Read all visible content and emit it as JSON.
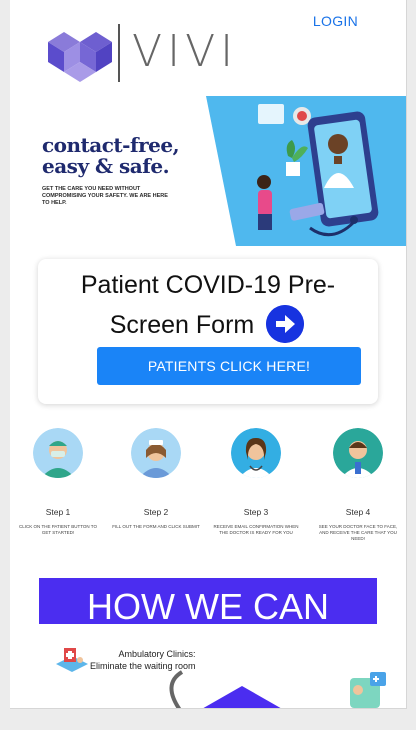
{
  "header": {
    "brand": "VIVI",
    "login_label": "LOGIN"
  },
  "hero": {
    "title_line1": "contact-free,",
    "title_line2": "easy & safe.",
    "subtitle": "GET THE CARE YOU NEED WITHOUT COMPROMISING YOUR SAFETY. WE ARE HERE TO HELP."
  },
  "form_card": {
    "title_line1": "Patient COVID-19 Pre-",
    "title_line2": "Screen Form",
    "button_label": "PATIENTS CLICK HERE!"
  },
  "steps": [
    {
      "label": "Step 1",
      "description": "CLICK ON THE PATIENT BUTTON TO GET STARTED!"
    },
    {
      "label": "Step 2",
      "description": "FILL OUT THE FORM AND CLICK SUBMIT"
    },
    {
      "label": "Step 3",
      "description": "RECEIVE EMAIL CONFIRMATION WHEN THE DOCTOR IS READY FOR YOU"
    },
    {
      "label": "Step 4",
      "description": "SEE YOUR DOCTOR FACE TO FACE, AND RECEIVE THE CARE THAT YOU NEED!"
    }
  ],
  "how_banner": "HOW WE CAN",
  "feature": {
    "line1": "Ambulatory Clinics:",
    "line2": "Eliminate the waiting room"
  },
  "colors": {
    "accent_blue": "#1a84f7",
    "login_blue": "#1a73e8",
    "banner_purple": "#4b2df0",
    "arrow_blue": "#1733e0",
    "hero_bg": "#4fb8ee"
  }
}
